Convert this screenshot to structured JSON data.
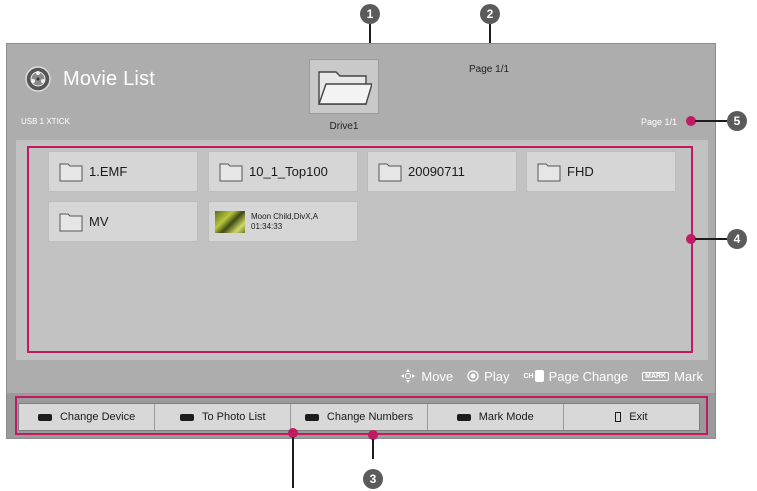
{
  "header": {
    "title": "Movie List",
    "device_label": "USB 1 XTICK",
    "drive_label": "Drive1",
    "page_top": "Page 1/1",
    "page_right": "Page 1/1"
  },
  "items": [
    {
      "type": "folder",
      "label": "1.EMF"
    },
    {
      "type": "folder",
      "label": "10_1_Top100"
    },
    {
      "type": "folder",
      "label": "20090711"
    },
    {
      "type": "folder",
      "label": "FHD"
    },
    {
      "type": "folder",
      "label": "MV"
    },
    {
      "type": "movie",
      "label": "Moon Child,DivX,A",
      "duration": "01:34:33"
    }
  ],
  "hints": {
    "move": "Move",
    "play": "Play",
    "page_change_prefix": "CH",
    "page_change": "Page Change",
    "mark_key": "MARK",
    "mark": "Mark"
  },
  "buttons": [
    "Change Device",
    "To Photo List",
    "Change Numbers",
    "Mark Mode",
    "Exit"
  ],
  "callouts": [
    "1",
    "2",
    "3",
    "4",
    "5"
  ],
  "colors": {
    "accent": "#c01a63",
    "screen_bg": "#adadad",
    "content_bg": "#c2c2c2",
    "tile_bg": "#d6d6d6",
    "badge": "#5b5b5b"
  }
}
